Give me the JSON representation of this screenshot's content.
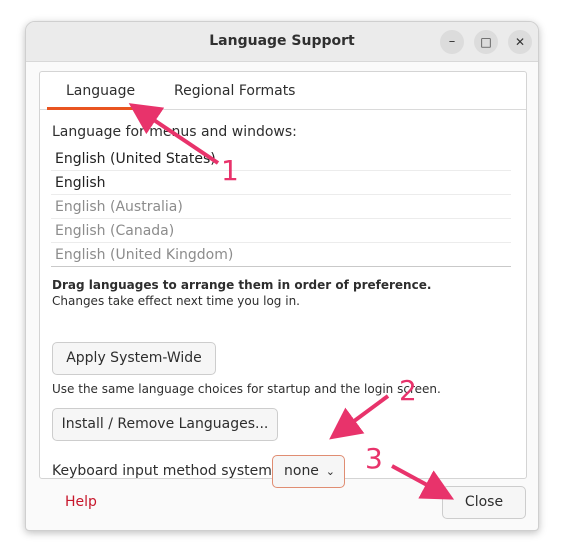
{
  "window": {
    "title": "Language Support",
    "minimize_glyph": "–",
    "maximize_glyph": "□",
    "close_glyph": "✕"
  },
  "tabs": [
    {
      "label": "Language",
      "active": true
    },
    {
      "label": "Regional Formats",
      "active": false
    }
  ],
  "language_panel": {
    "heading": "Language for menus and windows:",
    "languages": [
      {
        "label": "English (United States)",
        "active": true
      },
      {
        "label": "English",
        "active": true
      },
      {
        "label": "English (Australia)",
        "active": false
      },
      {
        "label": "English (Canada)",
        "active": false
      },
      {
        "label": "English (United Kingdom)",
        "active": false
      }
    ],
    "drag_hint": "Drag languages to arrange them in order of preference.",
    "drag_subhint": "Changes take effect next time you log in.",
    "apply_button": "Apply System-Wide",
    "apply_hint": "Use the same language choices for startup and the login screen.",
    "install_button": "Install / Remove Languages...",
    "keyboard_label": "Keyboard input method system:",
    "keyboard_value": "none"
  },
  "footer": {
    "help_label": "Help",
    "close_label": "Close"
  },
  "annotations": {
    "marker_1": "1",
    "marker_2": "2",
    "marker_3": "3",
    "color": "#e8336b"
  },
  "colors": {
    "accent": "#e95420",
    "help_link": "#c7162b"
  }
}
